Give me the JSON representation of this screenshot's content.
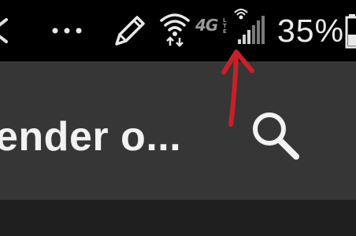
{
  "status_bar": {
    "network": "4G",
    "network_sub": "LTE",
    "battery": "35%",
    "icons": [
      "back-arrow-icon",
      "more-dots-icon",
      "pen-icon",
      "wifi-icon",
      "lte-activity-icon",
      "signal-icon",
      "battery-icon"
    ]
  },
  "toolbar": {
    "title": "ender o..."
  },
  "colors": {
    "status_bar_bg": "#000000",
    "toolbar_bg": "#363636",
    "content_bg": "#1f1f1f",
    "annotation_arrow": "#c8202a"
  }
}
